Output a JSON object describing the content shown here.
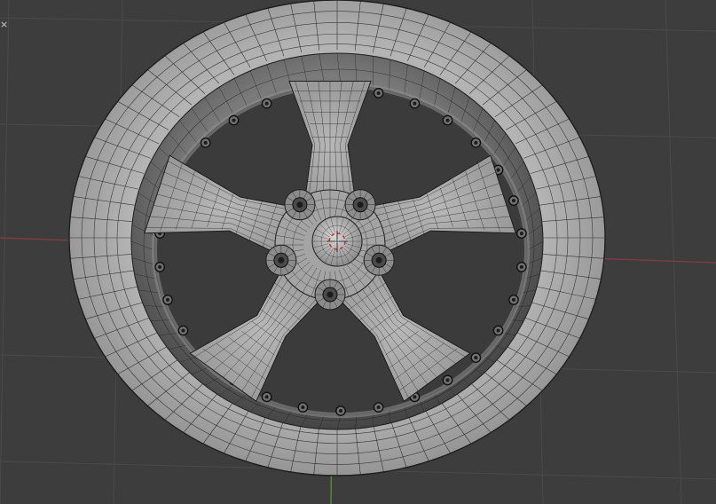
{
  "viewport": {
    "background": "#3d3d3d",
    "grid_color": "#4a4a4a",
    "x_axis_color": "#8a3b43",
    "y_axis_color": "#5d9b2f",
    "corner_glyph": "×"
  },
  "model": {
    "object": "car-wheel-rim",
    "display_mode": "wireframe-over-solid",
    "spoke_count": 5,
    "lug_nut_count": 5,
    "rim_bolt_count": 30,
    "mesh_base_color": "#a8a8a8",
    "wire_color": "#1e1e1e"
  }
}
